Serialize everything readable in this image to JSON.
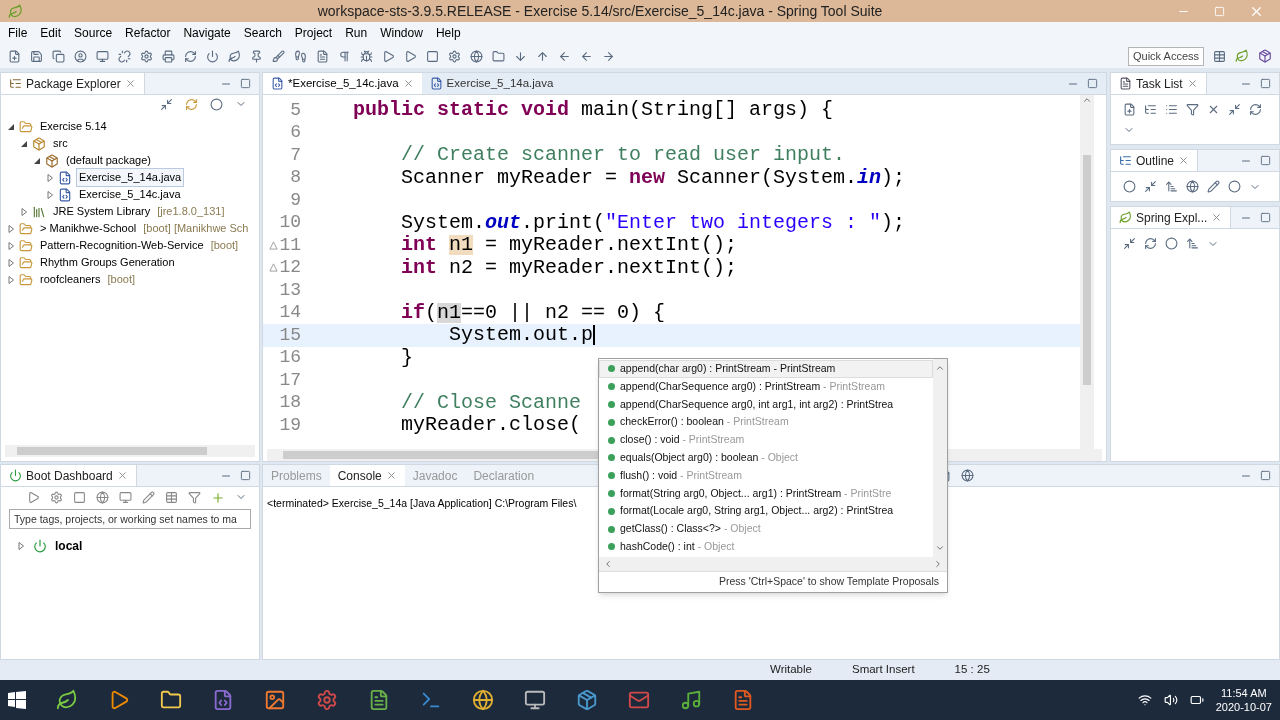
{
  "window": {
    "title": "workspace-sts-3.9.5.RELEASE - Exercise 5.14/src/Exercise_5_14c.java - Spring Tool Suite"
  },
  "menu": [
    "File",
    "Edit",
    "Source",
    "Refactor",
    "Navigate",
    "Search",
    "Project",
    "Run",
    "Window",
    "Help"
  ],
  "toolbar": {
    "quick_access": {
      "placeholder": "Quick Access"
    }
  },
  "package_explorer": {
    "title": "Package Explorer",
    "tree": [
      {
        "label": "Exercise 5.14",
        "kind": "project",
        "expanded": true,
        "selected": false,
        "children": [
          {
            "label": "src",
            "kind": "source_folder",
            "expanded": true,
            "selected": false,
            "children": [
              {
                "label": "(default package)",
                "kind": "package",
                "expanded": true,
                "selected": false,
                "children": [
                  {
                    "label": "Exercise_5_14a.java",
                    "kind": "file",
                    "expanded": false,
                    "selected": true
                  },
                  {
                    "label": "Exercise_5_14c.java",
                    "kind": "file",
                    "expanded": false,
                    "selected": false
                  }
                ]
              }
            ]
          },
          {
            "label": "JRE System Library",
            "suffix": "[jre1.8.0_131]",
            "kind": "library",
            "expanded": false,
            "selected": false
          }
        ]
      },
      {
        "label": "> Manikhwe-School",
        "suffix": "[boot] [Manikhwe Sch",
        "kind": "project",
        "expanded": false,
        "selected": false
      },
      {
        "label": "Pattern-Recognition-Web-Service",
        "suffix": "[boot]",
        "kind": "project",
        "expanded": false,
        "selected": false
      },
      {
        "label": "Rhythm Groups Generation",
        "kind": "project",
        "expanded": false,
        "selected": false
      },
      {
        "label": "roofcleaners",
        "suffix": "[boot]",
        "kind": "project",
        "expanded": false,
        "selected": false
      }
    ]
  },
  "editor": {
    "tabs": [
      {
        "label": "*Exercise_5_14c.java",
        "selected": true
      },
      {
        "label": "Exercise_5_14a.java",
        "selected": false
      }
    ],
    "lines": [
      {
        "number": "5",
        "warning": false,
        "current": false,
        "tokens": [
          {
            "text": "public static void",
            "kind": "keyword"
          },
          {
            "text": " main(String[] args) {",
            "kind": "plain"
          }
        ],
        "children": [
          {
            "number": "6",
            "warning": false,
            "current": false
          },
          {
            "number": "7",
            "warning": false,
            "current": false,
            "tokens": [
              {
                "text": "// Create scanner to read user input.",
                "kind": "comment"
              }
            ]
          },
          {
            "number": "8",
            "warning": false,
            "current": false,
            "tokens": [
              {
                "text": "Scanner myReader = ",
                "kind": "plain"
              },
              {
                "text": "new",
                "kind": "keyword"
              },
              {
                "text": " Scanner(System.",
                "kind": "plain"
              },
              {
                "text": "in",
                "kind": "field"
              },
              {
                "text": ");",
                "kind": "plain"
              }
            ]
          },
          {
            "number": "9",
            "warning": false,
            "current": false
          },
          {
            "number": "10",
            "warning": false,
            "current": false,
            "tokens": [
              {
                "text": "System.",
                "kind": "plain"
              },
              {
                "text": "out",
                "kind": "field"
              },
              {
                "text": ".print(",
                "kind": "plain"
              },
              {
                "text": "\"Enter two integers : \"",
                "kind": "string"
              },
              {
                "text": ");",
                "kind": "plain"
              }
            ]
          },
          {
            "number": "11",
            "warning": true,
            "current": false,
            "tokens": [
              {
                "text": "int ",
                "kind": "keyword"
              },
              {
                "text": "n1",
                "kind": "occurrence_write"
              },
              {
                "text": " = myReader.nextInt();",
                "kind": "plain"
              }
            ]
          },
          {
            "number": "12",
            "warning": true,
            "current": false,
            "tokens": [
              {
                "text": "int",
                "kind": "keyword"
              },
              {
                "text": " n2 = myReader.nextInt();",
                "kind": "plain"
              }
            ]
          },
          {
            "number": "13",
            "warning": false,
            "current": false
          },
          {
            "number": "14",
            "warning": false,
            "current": false,
            "tokens": [
              {
                "text": "if",
                "kind": "keyword"
              },
              {
                "text": "(",
                "kind": "plain"
              },
              {
                "text": "n1",
                "kind": "occurrence_read"
              },
              {
                "text": "==0 || n2 == 0) {",
                "kind": "plain"
              }
            ],
            "children": [
              {
                "number": "15",
                "warning": false,
                "current": true,
                "tokens": [
                  {
                    "text": "System.out.p",
                    "kind": "plain"
                  }
                ]
              }
            ]
          },
          {
            "number": "16",
            "warning": false,
            "current": false,
            "tokens": [
              {
                "text": "}",
                "kind": "plain"
              }
            ]
          },
          {
            "number": "17",
            "warning": false,
            "current": false
          },
          {
            "number": "18",
            "warning": false,
            "current": false,
            "tokens": [
              {
                "text": "// Close Scanne",
                "kind": "comment"
              }
            ]
          },
          {
            "number": "19",
            "warning": false,
            "current": false,
            "tokens": [
              {
                "text": "myReader.close(",
                "kind": "plain"
              }
            ]
          }
        ]
      }
    ]
  },
  "completion_popup": {
    "items": [
      {
        "signature": "append(char arg0) : PrintStream",
        "owner": "- PrintStream",
        "selected": true
      },
      {
        "signature": "append(CharSequence arg0) : PrintStream",
        "owner": "- PrintStream",
        "selected": false
      },
      {
        "signature": "append(CharSequence arg0, int arg1, int arg2) : PrintStrea",
        "selected": false
      },
      {
        "signature": "checkError() : boolean",
        "owner": "- PrintStream",
        "selected": false
      },
      {
        "signature": "close() : void",
        "owner": "- PrintStream",
        "selected": false
      },
      {
        "signature": "equals(Object arg0) : boolean",
        "owner": "- Object",
        "selected": false
      },
      {
        "signature": "flush() : void",
        "owner": "- PrintStream",
        "selected": false
      },
      {
        "signature": "format(String arg0, Object... arg1) : PrintStream",
        "owner": "- PrintStre",
        "selected": false
      },
      {
        "signature": "format(Locale arg0, String arg1, Object... arg2) : PrintStrea",
        "selected": false
      },
      {
        "signature": "getClass() : Class<?>",
        "owner": "- Object",
        "selected": false
      },
      {
        "signature": "hashCode() : int",
        "owner": "- Object",
        "selected": false
      }
    ],
    "footer": "Press 'Ctrl+Space' to show Template Proposals"
  },
  "right_panels": [
    {
      "title": "Task List",
      "kind": "task_list"
    },
    {
      "title": "Outline",
      "kind": "outline"
    },
    {
      "title": "Spring Expl...",
      "kind": "spring_explorer"
    }
  ],
  "boot_dashboard": {
    "title": "Boot Dashboard",
    "filter": {
      "placeholder": "Type tags, projects, or working set names to ma"
    },
    "tree": [
      {
        "label": "local",
        "expanded": false
      }
    ]
  },
  "bottom_panel": {
    "tabs": [
      {
        "label": "Problems",
        "selected": false
      },
      {
        "label": "Console",
        "selected": true
      },
      {
        "label": "Javadoc",
        "selected": false
      },
      {
        "label": "Declaration",
        "selected": false
      }
    ],
    "console_text": "<terminated> Exercise_5_14a [Java Application] C:\\Program Files\\"
  },
  "status_bar": [
    "Writable",
    "Smart Insert",
    "15 : 25"
  ],
  "taskbar": {
    "time": "11:54 AM",
    "date": "2020-10-07"
  }
}
